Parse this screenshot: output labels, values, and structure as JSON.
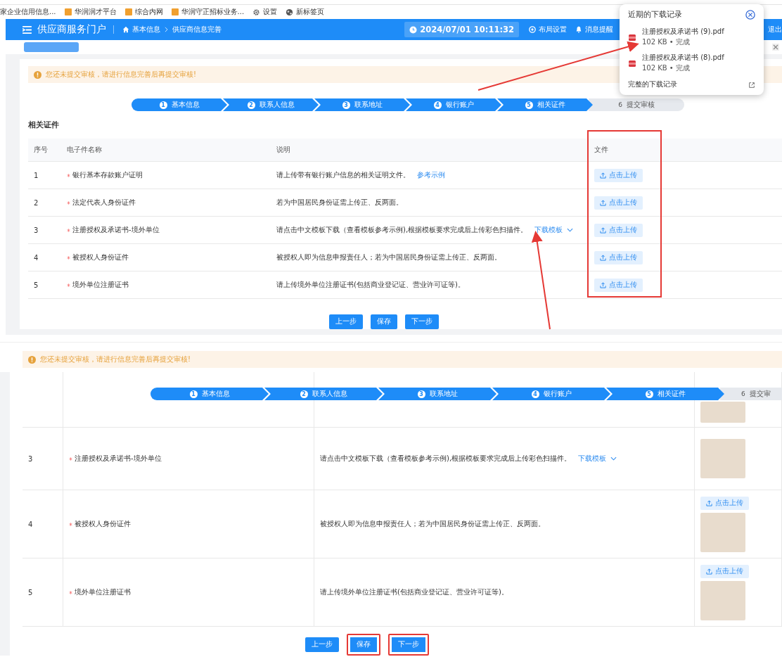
{
  "bookmarks": [
    {
      "label": "家企业信用信息...",
      "kind": "plain"
    },
    {
      "label": "华润润才平台",
      "kind": "app"
    },
    {
      "label": "综合内网",
      "kind": "app"
    },
    {
      "label": "华润守正招标业务...",
      "kind": "app"
    },
    {
      "label": "设置",
      "kind": "gear"
    },
    {
      "label": "新标签页",
      "kind": "globe"
    }
  ],
  "header": {
    "title": "供应商服务门户",
    "breadcrumb": [
      "基本信息",
      "供应商信息完善"
    ],
    "time": "2024/07/01 10:11:32",
    "actions": [
      {
        "label": "布局设置",
        "kind": "eye"
      },
      {
        "label": "消息提醒",
        "kind": "bell"
      }
    ],
    "logout": "退出"
  },
  "download_panel": {
    "title": "近期的下载记录",
    "items": [
      {
        "name": "注册授权及承诺书 (9).pdf",
        "meta": "102 KB • 完成"
      },
      {
        "name": "注册授权及承诺书 (8).pdf",
        "meta": "102 KB • 完成"
      }
    ],
    "footer": "完整的下载记录"
  },
  "top": {
    "alert": "您还未提交审核，请进行信息完善后再提交审核!",
    "steps": [
      {
        "number": "1",
        "label": "基本信息",
        "done": true
      },
      {
        "number": "2",
        "label": "联系人信息",
        "done": true
      },
      {
        "number": "3",
        "label": "联系地址",
        "done": true
      },
      {
        "number": "4",
        "label": "银行账户",
        "done": true
      },
      {
        "number": "5",
        "label": "相关证件",
        "done": true
      },
      {
        "number": "6",
        "label": "提交审核",
        "done": false
      }
    ],
    "section_title": "相关证件",
    "columns": [
      "序号",
      "电子件名称",
      "说明",
      "文件"
    ],
    "rows": [
      {
        "index": "1",
        "name": "银行基本存款账户证明",
        "required": true,
        "description": "请上传带有银行账户信息的相关证明文件。",
        "link": "参考示例",
        "upload": "点击上传"
      },
      {
        "index": "2",
        "name": "法定代表人身份证件",
        "required": true,
        "description": "若为中国居民身份证需上传正、反两面。",
        "upload": "点击上传"
      },
      {
        "index": "3",
        "name": "注册授权及承诺书-境外单位",
        "required": true,
        "description": "请点击中文模板下载（查看模板参考示例),根据模板要求完成后上传彩色扫描件。",
        "link": "下载模板",
        "dropdown": true,
        "upload": "点击上传"
      },
      {
        "index": "4",
        "name": "被授权人身份证件",
        "required": true,
        "description": "被授权人即为信息申报责任人；若为中国居民身份证需上传正、反两面。",
        "upload": "点击上传"
      },
      {
        "index": "5",
        "name": "境外单位注册证书",
        "required": true,
        "description": "请上传境外单位注册证书(包括商业登记证、营业许可证等)。",
        "upload": "点击上传"
      }
    ],
    "buttons": [
      {
        "label": "上一步"
      },
      {
        "label": "保存"
      },
      {
        "label": "下一步"
      }
    ]
  },
  "bottom": {
    "alert": "您还未提交审核，请进行信息完善后再提交审核!",
    "steps": [
      {
        "number": "1",
        "label": "基本信息",
        "done": true
      },
      {
        "number": "2",
        "label": "联系人信息",
        "done": true
      },
      {
        "number": "3",
        "label": "联系地址",
        "done": true
      },
      {
        "number": "4",
        "label": "银行账户",
        "done": true
      },
      {
        "number": "5",
        "label": "相关证件",
        "done": true
      },
      {
        "number": "6",
        "label": "提交审",
        "done": false
      }
    ],
    "rows": [
      {
        "has_file": true
      },
      {
        "index": "3",
        "name": "注册授权及承诺书-境外单位",
        "required": true,
        "description": "请点击中文模板下载（查看模板参考示例),根据模板要求完成后上传彩色扫描件。",
        "link": "下载模板",
        "dropdown": true,
        "has_file": true
      },
      {
        "index": "4",
        "name": "被授权人身份证件",
        "required": true,
        "description": "被授权人即为信息申报责任人；若为中国居民身份证需上传正、反两面。",
        "upload": "点击上传",
        "has_file": true
      },
      {
        "index": "5",
        "name": "境外单位注册证书",
        "required": true,
        "description": "请上传境外单位注册证书(包括商业登记证、营业许可证等)。",
        "upload": "点击上传",
        "has_file": true
      }
    ],
    "buttons": [
      {
        "label": "上一步",
        "highlighted": false
      },
      {
        "label": "保存",
        "highlighted": true
      },
      {
        "label": "下一步",
        "highlighted": true
      }
    ]
  }
}
